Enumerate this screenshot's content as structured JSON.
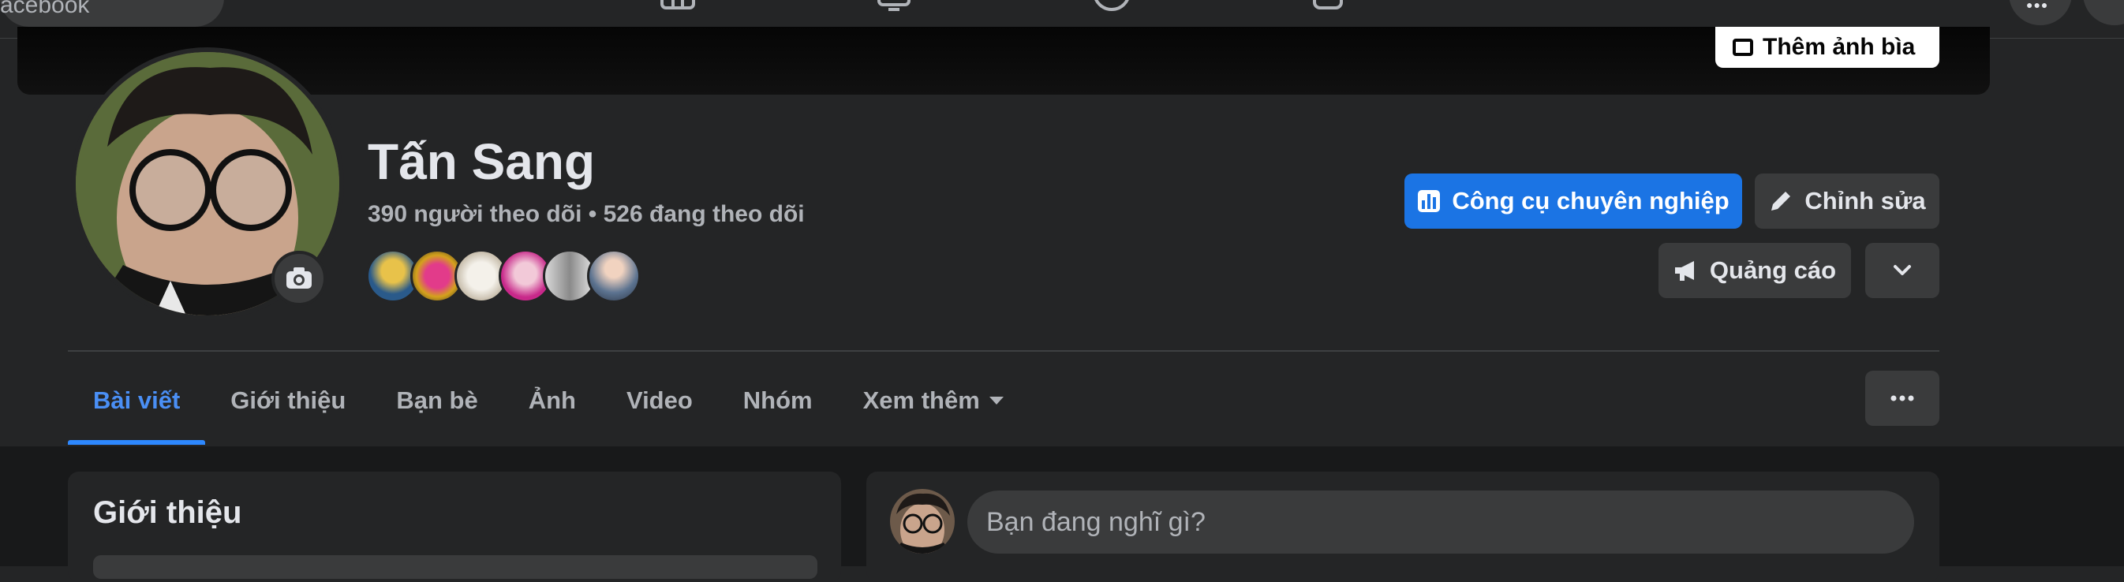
{
  "topbar": {
    "search_text": "acebook",
    "icons": [
      "marketplace-icon",
      "watch-icon",
      "profile-icon",
      "gaming-icon"
    ],
    "menu_icon": "grid-menu-icon"
  },
  "cover": {
    "add_cover_label": "Thêm ảnh bìa"
  },
  "profile": {
    "name": "Tấn Sang",
    "followers_text": "390 người theo dõi",
    "separator": "•",
    "following_text": "526 đang theo dõi"
  },
  "actions": {
    "pro_tools_label": "Công cụ chuyên nghiệp",
    "edit_label": "Chỉnh sửa",
    "ads_label": "Quảng cáo"
  },
  "tabs": [
    {
      "label": "Bài viết",
      "active": true
    },
    {
      "label": "Giới thiệu"
    },
    {
      "label": "Bạn bè"
    },
    {
      "label": "Ảnh"
    },
    {
      "label": "Video"
    },
    {
      "label": "Nhóm"
    },
    {
      "label": "Xem thêm"
    }
  ],
  "intro": {
    "title": "Giới thiệu"
  },
  "composer": {
    "placeholder": "Bạn đang nghĩ gì?"
  },
  "colors": {
    "background": "#242526",
    "accent": "#1b74e4",
    "active_tab": "#4a8ff5",
    "button_grey": "#3a3b3c",
    "feed_background": "#18191a"
  }
}
